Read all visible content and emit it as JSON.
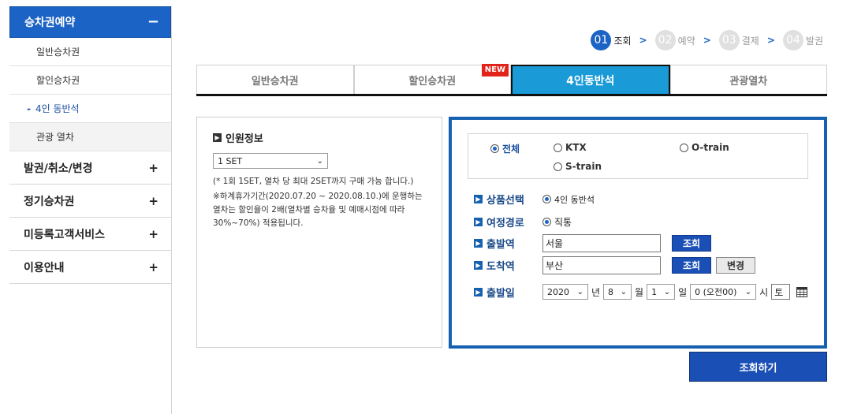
{
  "sidebar": {
    "header": {
      "label": "승차권예약",
      "toggle": "−"
    },
    "subitems": [
      {
        "label": "일반승차권",
        "marker": ""
      },
      {
        "label": "할인승차권",
        "marker": ""
      },
      {
        "label": "4인 동반석",
        "marker": "-"
      },
      {
        "label": "관광 열차",
        "marker": ""
      }
    ],
    "categories": [
      {
        "label": "발권/취소/변경",
        "toggle": "+"
      },
      {
        "label": "정기승차권",
        "toggle": "+"
      },
      {
        "label": "미등록고객서비스",
        "toggle": "+"
      },
      {
        "label": "이용안내",
        "toggle": "+"
      }
    ]
  },
  "steps": [
    {
      "num": "01",
      "label": "조회",
      "arrow": ">"
    },
    {
      "num": "02",
      "label": "예약",
      "arrow": ">"
    },
    {
      "num": "03",
      "label": "결제",
      "arrow": ">"
    },
    {
      "num": "04",
      "label": "발권",
      "arrow": ""
    }
  ],
  "tabs": [
    {
      "label": "일반승차권",
      "badge": ""
    },
    {
      "label": "할인승차권",
      "badge": "NEW"
    },
    {
      "label": "4인동반석",
      "badge": ""
    },
    {
      "label": "관광열차",
      "badge": ""
    }
  ],
  "person_info": {
    "title": "인원정보",
    "select_value": "1 SET",
    "note1": "(* 1회 1SET, 열차 당 최대 2SET까지 구매 가능 합니다.)",
    "note2": "※하계휴가기간(2020.07.20 ~ 2020.08.10.)에 운행하는 열차는 할인율이 2배(열차별 승차율 및 예매시점에 따라 30%~70%) 적용됩니다."
  },
  "search": {
    "train_types": [
      "전체",
      "KTX",
      "O-train",
      "S-train"
    ],
    "product_label": "상품선택",
    "product_value": "4인 동반석",
    "route_label": "여정경로",
    "route_value": "직통",
    "departure_label": "출발역",
    "departure_value": "서울",
    "arrival_label": "도착역",
    "arrival_value": "부산",
    "lookup_button": "조회",
    "swap_button": "변경",
    "date_label": "출발일",
    "year": "2020",
    "year_unit": "년",
    "month": "8",
    "month_unit": "월",
    "day": "1",
    "day_unit": "일",
    "hour": "0 (오전00)",
    "hour_unit": "시",
    "weekday": "토"
  },
  "submit_button": "조회하기",
  "colors": {
    "primary": "#1c63c6",
    "tab_active": "#1a9ad6",
    "panel_border": "#1660b0",
    "badge": "#e2231a"
  }
}
